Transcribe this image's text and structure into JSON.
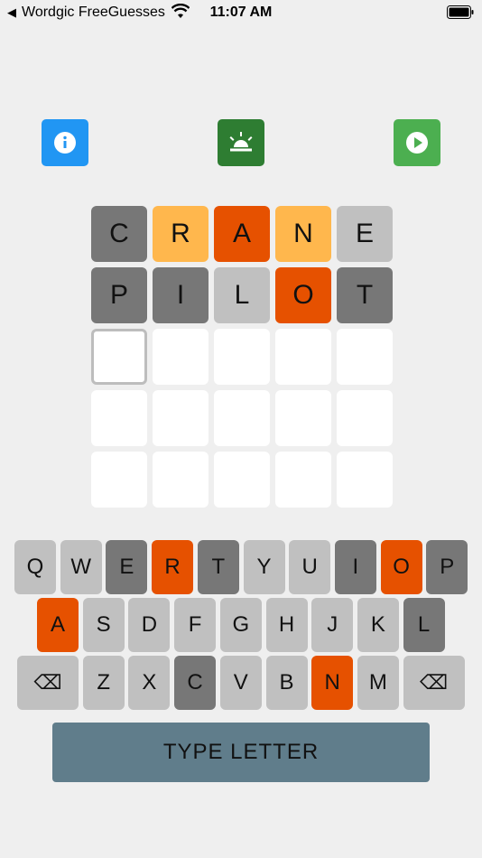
{
  "status_bar": {
    "back_symbol": "◀",
    "app_name": "Wordgic FreeGuesses",
    "time": "11:07 AM",
    "icons": [
      "wifi-icon",
      "battery-icon"
    ]
  },
  "toolbar": {
    "buttons": [
      {
        "name": "info-button",
        "icon": "info-icon",
        "color": "#2196f3"
      },
      {
        "name": "alarm-button",
        "icon": "alarm-light-icon",
        "color": "#2e7d32"
      },
      {
        "name": "play-button",
        "icon": "play-icon",
        "color": "#4caf50"
      }
    ]
  },
  "colors": {
    "absent": "#777777",
    "light": "#c0c0c0",
    "orange": "#e65100",
    "yellow": "#ffb74d",
    "empty": "#ffffff",
    "type_button": "#607d8b"
  },
  "board": {
    "rows": [
      [
        {
          "l": "C",
          "s": "gray"
        },
        {
          "l": "R",
          "s": "yellow"
        },
        {
          "l": "A",
          "s": "orange"
        },
        {
          "l": "N",
          "s": "yellow"
        },
        {
          "l": "E",
          "s": "light"
        }
      ],
      [
        {
          "l": "P",
          "s": "gray"
        },
        {
          "l": "I",
          "s": "gray"
        },
        {
          "l": "L",
          "s": "light"
        },
        {
          "l": "O",
          "s": "orange"
        },
        {
          "l": "T",
          "s": "gray"
        }
      ],
      [
        {
          "l": "",
          "s": "active"
        },
        {
          "l": "",
          "s": "empty"
        },
        {
          "l": "",
          "s": "empty"
        },
        {
          "l": "",
          "s": "empty"
        },
        {
          "l": "",
          "s": "empty"
        }
      ],
      [
        {
          "l": "",
          "s": "empty"
        },
        {
          "l": "",
          "s": "empty"
        },
        {
          "l": "",
          "s": "empty"
        },
        {
          "l": "",
          "s": "empty"
        },
        {
          "l": "",
          "s": "empty"
        }
      ],
      [
        {
          "l": "",
          "s": "empty"
        },
        {
          "l": "",
          "s": "empty"
        },
        {
          "l": "",
          "s": "empty"
        },
        {
          "l": "",
          "s": "empty"
        },
        {
          "l": "",
          "s": "empty"
        }
      ]
    ]
  },
  "keyboard": {
    "row1": [
      {
        "k": "Q",
        "s": "light"
      },
      {
        "k": "W",
        "s": "light"
      },
      {
        "k": "E",
        "s": "gray"
      },
      {
        "k": "R",
        "s": "orange"
      },
      {
        "k": "T",
        "s": "gray"
      },
      {
        "k": "Y",
        "s": "light"
      },
      {
        "k": "U",
        "s": "light"
      },
      {
        "k": "I",
        "s": "gray"
      },
      {
        "k": "O",
        "s": "orange"
      },
      {
        "k": "P",
        "s": "gray"
      }
    ],
    "row2": [
      {
        "k": "A",
        "s": "orange"
      },
      {
        "k": "S",
        "s": "light"
      },
      {
        "k": "D",
        "s": "light"
      },
      {
        "k": "F",
        "s": "light"
      },
      {
        "k": "G",
        "s": "light"
      },
      {
        "k": "H",
        "s": "light"
      },
      {
        "k": "J",
        "s": "light"
      },
      {
        "k": "K",
        "s": "light"
      },
      {
        "k": "L",
        "s": "gray"
      }
    ],
    "row3": [
      {
        "k": "⌫",
        "s": "light",
        "wide": true
      },
      {
        "k": "Z",
        "s": "light"
      },
      {
        "k": "X",
        "s": "light"
      },
      {
        "k": "C",
        "s": "gray"
      },
      {
        "k": "V",
        "s": "light"
      },
      {
        "k": "B",
        "s": "light"
      },
      {
        "k": "N",
        "s": "orange"
      },
      {
        "k": "M",
        "s": "light"
      },
      {
        "k": "⌫",
        "s": "light",
        "wide": true
      }
    ]
  },
  "type_button": {
    "label": "TYPE LETTER"
  }
}
